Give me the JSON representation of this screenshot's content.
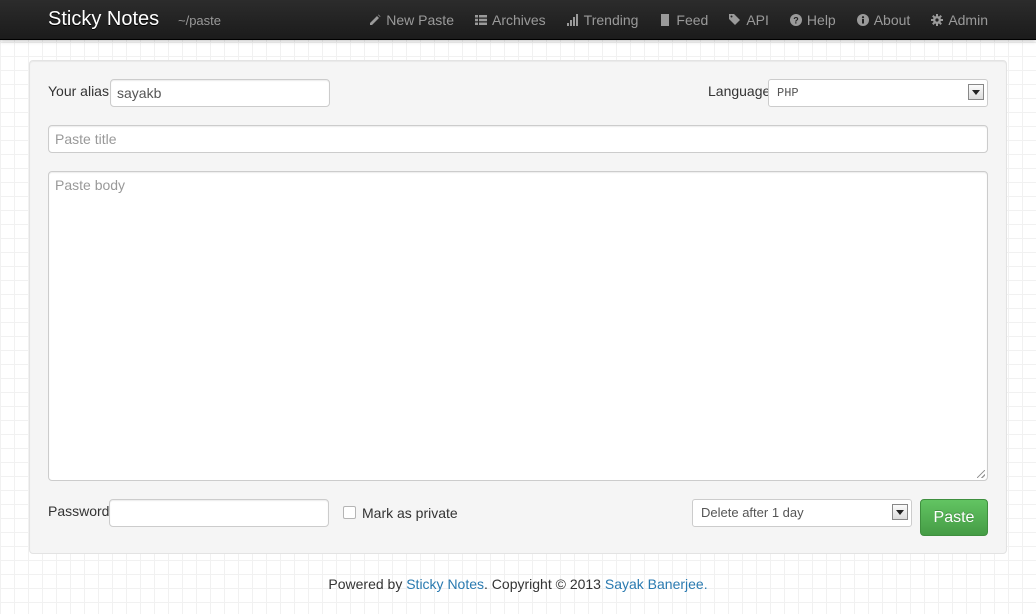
{
  "navbar": {
    "brand": "Sticky Notes",
    "subtitle": "~/paste",
    "items": [
      {
        "label": "New Paste",
        "icon": "pencil-icon"
      },
      {
        "label": "Archives",
        "icon": "list-icon"
      },
      {
        "label": "Trending",
        "icon": "bar-chart-icon"
      },
      {
        "label": "Feed",
        "icon": "book-icon"
      },
      {
        "label": "API",
        "icon": "tags-icon"
      },
      {
        "label": "Help",
        "icon": "question-circle-icon"
      },
      {
        "label": "About",
        "icon": "info-circle-icon"
      },
      {
        "label": "Admin",
        "icon": "gear-icon"
      }
    ]
  },
  "form": {
    "alias_label": "Your alias",
    "alias_value": "sayakb",
    "language_label": "Language",
    "language_value": "PHP",
    "title_placeholder": "Paste title",
    "body_placeholder": "Paste body",
    "password_label": "Password",
    "password_value": "",
    "private_label": "Mark as private",
    "private_checked": false,
    "expire_value": "Delete after 1 day",
    "submit_label": "Paste"
  },
  "footer": {
    "prefix": "Powered by",
    "app_link": "Sticky Notes",
    "middle": ". Copyright © 2013",
    "author_link": "Sayak Banerjee."
  },
  "colors": {
    "navbar_bg": "#1b1b1b",
    "accent_green": "#51a351",
    "link_blue": "#2a7ab0"
  }
}
